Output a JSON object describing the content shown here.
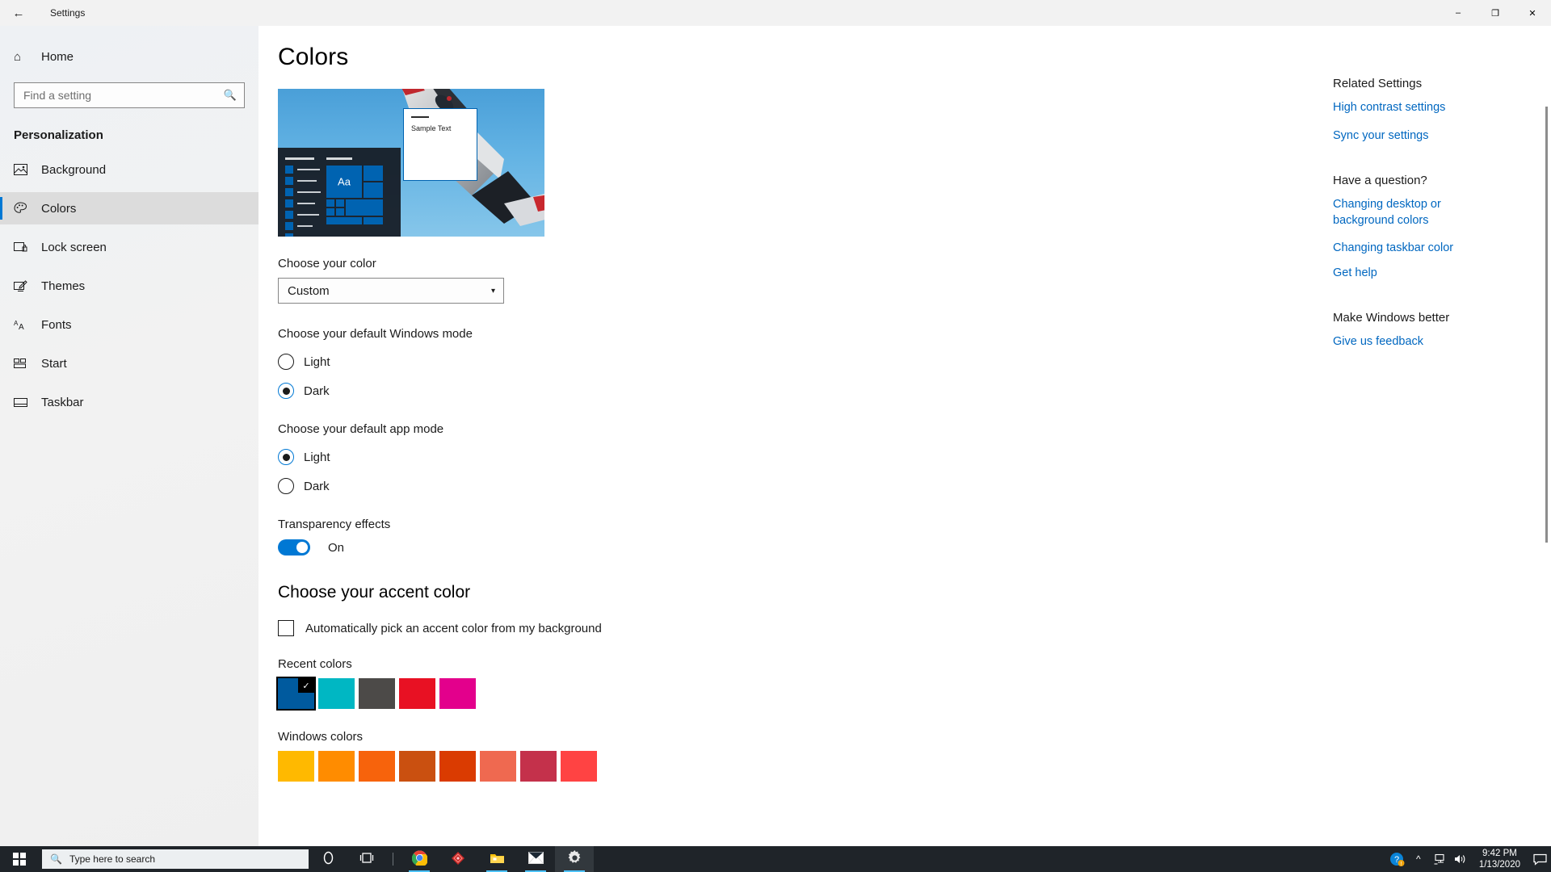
{
  "window": {
    "title": "Settings",
    "back_icon": "back-arrow-icon",
    "minimize_label": "–",
    "maximize_label": "❐",
    "close_label": "✕"
  },
  "sidebar": {
    "home_label": "Home",
    "home_icon": "home-icon",
    "search": {
      "placeholder": "Find a setting",
      "value": "",
      "icon": "search-icon"
    },
    "section_title": "Personalization",
    "items": [
      {
        "label": "Background",
        "icon": "image-icon",
        "selected": false
      },
      {
        "label": "Colors",
        "icon": "palette-icon",
        "selected": true
      },
      {
        "label": "Lock screen",
        "icon": "lock-screen-icon",
        "selected": false
      },
      {
        "label": "Themes",
        "icon": "themes-brush-icon",
        "selected": false
      },
      {
        "label": "Fonts",
        "icon": "fonts-icon",
        "selected": false
      },
      {
        "label": "Start",
        "icon": "start-tiles-icon",
        "selected": false
      },
      {
        "label": "Taskbar",
        "icon": "taskbar-icon",
        "selected": false
      }
    ]
  },
  "main": {
    "page_title": "Colors",
    "preview": {
      "sample_text": "Sample Text",
      "tile_letters": "Aa",
      "accent_color": "#0063b1"
    },
    "choose_color": {
      "label": "Choose your color",
      "value": "Custom",
      "chevron_icon": "chevron-down-icon"
    },
    "windows_mode": {
      "label": "Choose your default Windows mode",
      "options": [
        {
          "label": "Light",
          "selected": false
        },
        {
          "label": "Dark",
          "selected": true
        }
      ]
    },
    "app_mode": {
      "label": "Choose your default app mode",
      "options": [
        {
          "label": "Light",
          "selected": true
        },
        {
          "label": "Dark",
          "selected": false
        }
      ]
    },
    "transparency": {
      "label": "Transparency effects",
      "state": "On",
      "on": true
    },
    "accent": {
      "heading": "Choose your accent color",
      "auto_pick_label": "Automatically pick an accent color from my background",
      "auto_pick_checked": false,
      "recent_label": "Recent colors",
      "recent_colors": [
        {
          "hex": "#005a9e",
          "selected": true
        },
        {
          "hex": "#00b7c3",
          "selected": false
        },
        {
          "hex": "#4c4a48",
          "selected": false
        },
        {
          "hex": "#e81123",
          "selected": false
        },
        {
          "hex": "#e3008c",
          "selected": false
        }
      ],
      "check_icon": "check-icon",
      "windows_colors_label": "Windows colors",
      "windows_colors": [
        "#ffb900",
        "#ff8c00",
        "#f7630c",
        "#ca5010",
        "#da3b01",
        "#ef6950",
        "#c4314b",
        "#ff4343"
      ]
    }
  },
  "rail": {
    "related_heading": "Related Settings",
    "related_links": [
      "High contrast settings",
      "Sync your settings"
    ],
    "question_heading": "Have a question?",
    "question_links": [
      "Changing desktop or background colors",
      "Changing taskbar color",
      "Get help"
    ],
    "feedback_heading": "Make Windows better",
    "feedback_links": [
      "Give us feedback"
    ]
  },
  "taskbar": {
    "start_icon": "windows-start-icon",
    "search_placeholder": "Type here to search",
    "search_icon": "search-icon",
    "cortana_icon": "cortana-circle-icon",
    "taskview_icon": "task-view-icon",
    "apps": [
      {
        "name": "chrome-icon"
      },
      {
        "name": "app-diamond-icon"
      },
      {
        "name": "file-explorer-icon"
      },
      {
        "name": "mail-icon"
      },
      {
        "name": "settings-gear-icon"
      }
    ],
    "tray": {
      "help_icon": "help-warning-icon",
      "chevron_icon": "chevron-up-icon",
      "network_icon": "network-icon",
      "volume_icon": "volume-icon",
      "time": "9:42 PM",
      "date": "1/13/2020",
      "notifications_icon": "notifications-icon"
    }
  }
}
